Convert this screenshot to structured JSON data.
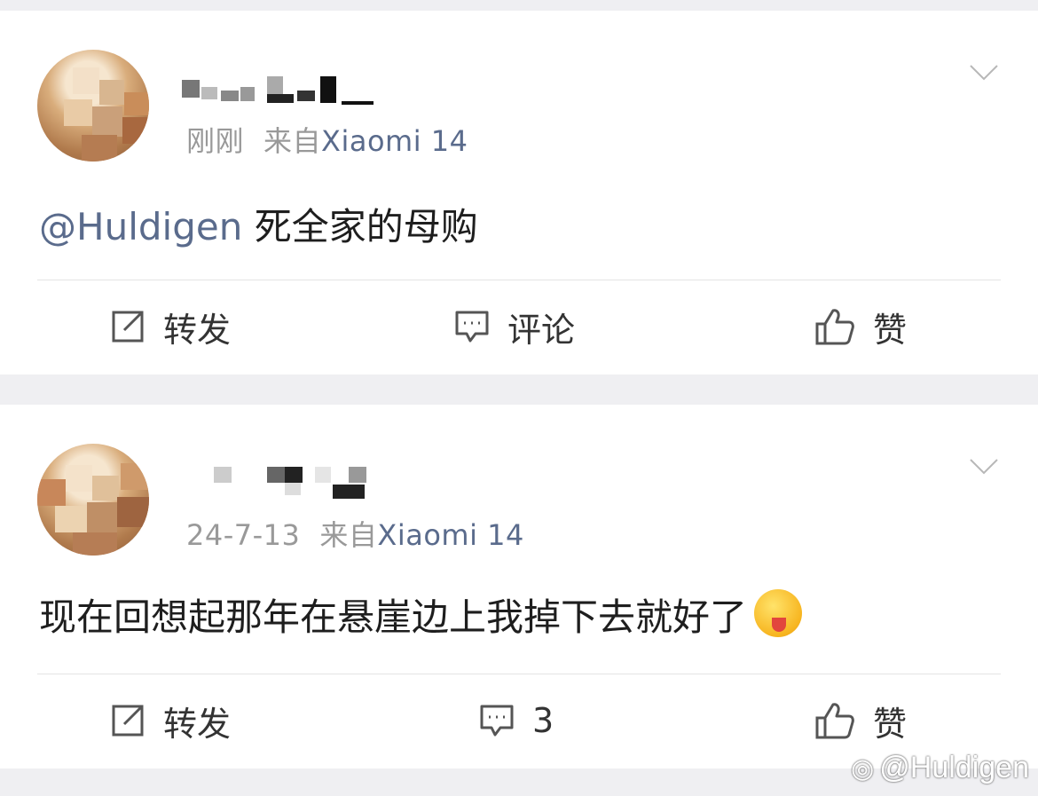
{
  "posts": [
    {
      "time": "刚刚",
      "source_prefix": "来自",
      "device": "Xiaomi 14",
      "mention": "@Huldigen",
      "text": "死全家的母购",
      "actions": {
        "repost": "转发",
        "comment": "评论",
        "like": "赞"
      }
    },
    {
      "time": "24-7-13",
      "source_prefix": "来自",
      "device": "Xiaomi 14",
      "text": "现在回想起那年在悬崖边上我掉下去就好了",
      "emoji": "winking-tongue-emoji",
      "actions": {
        "repost": "转发",
        "comment": "3",
        "like": "赞"
      }
    }
  ],
  "watermark": "@Huldigen",
  "colors": {
    "link": "#5a6b8c",
    "meta": "#999999",
    "text": "#1e1e1e",
    "bg": "#efeff2"
  }
}
